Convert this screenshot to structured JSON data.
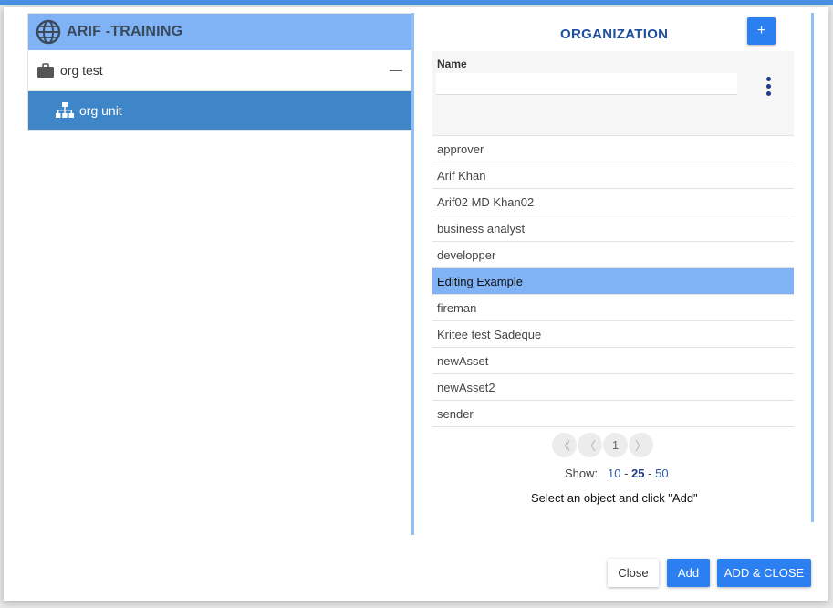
{
  "tree": {
    "root_label": "ARIF -TRAINING",
    "items": [
      {
        "label": "org test",
        "toggle": "—"
      },
      {
        "label": "org unit"
      }
    ]
  },
  "panel": {
    "title": "ORGANIZATION",
    "add_label": "+",
    "filter": {
      "label": "Name",
      "value": ""
    },
    "items": [
      {
        "label": "approver"
      },
      {
        "label": "Arif Khan"
      },
      {
        "label": "Arif02 MD Khan02"
      },
      {
        "label": "business analyst"
      },
      {
        "label": "developper"
      },
      {
        "label": "Editing Example",
        "selected": true
      },
      {
        "label": "fireman"
      },
      {
        "label": "Kritee test Sadeque"
      },
      {
        "label": "newAsset"
      },
      {
        "label": "newAsset2"
      },
      {
        "label": "sender"
      }
    ],
    "pagination": {
      "first": "《",
      "prev": "〈",
      "current": "1",
      "next": "〉"
    },
    "page_size": {
      "label": "Show:",
      "options": [
        "10",
        "25",
        "50"
      ],
      "selected": "25",
      "sep": "-"
    },
    "hint": "Select an object and click \"Add\""
  },
  "footer": {
    "close_label": "Close",
    "add_label": "Add",
    "add_close_label": "ADD & CLOSE"
  },
  "colors": {
    "accent": "#2b7ff0",
    "header_blue": "#7fb3f5",
    "selected_node": "#3f86c8"
  }
}
